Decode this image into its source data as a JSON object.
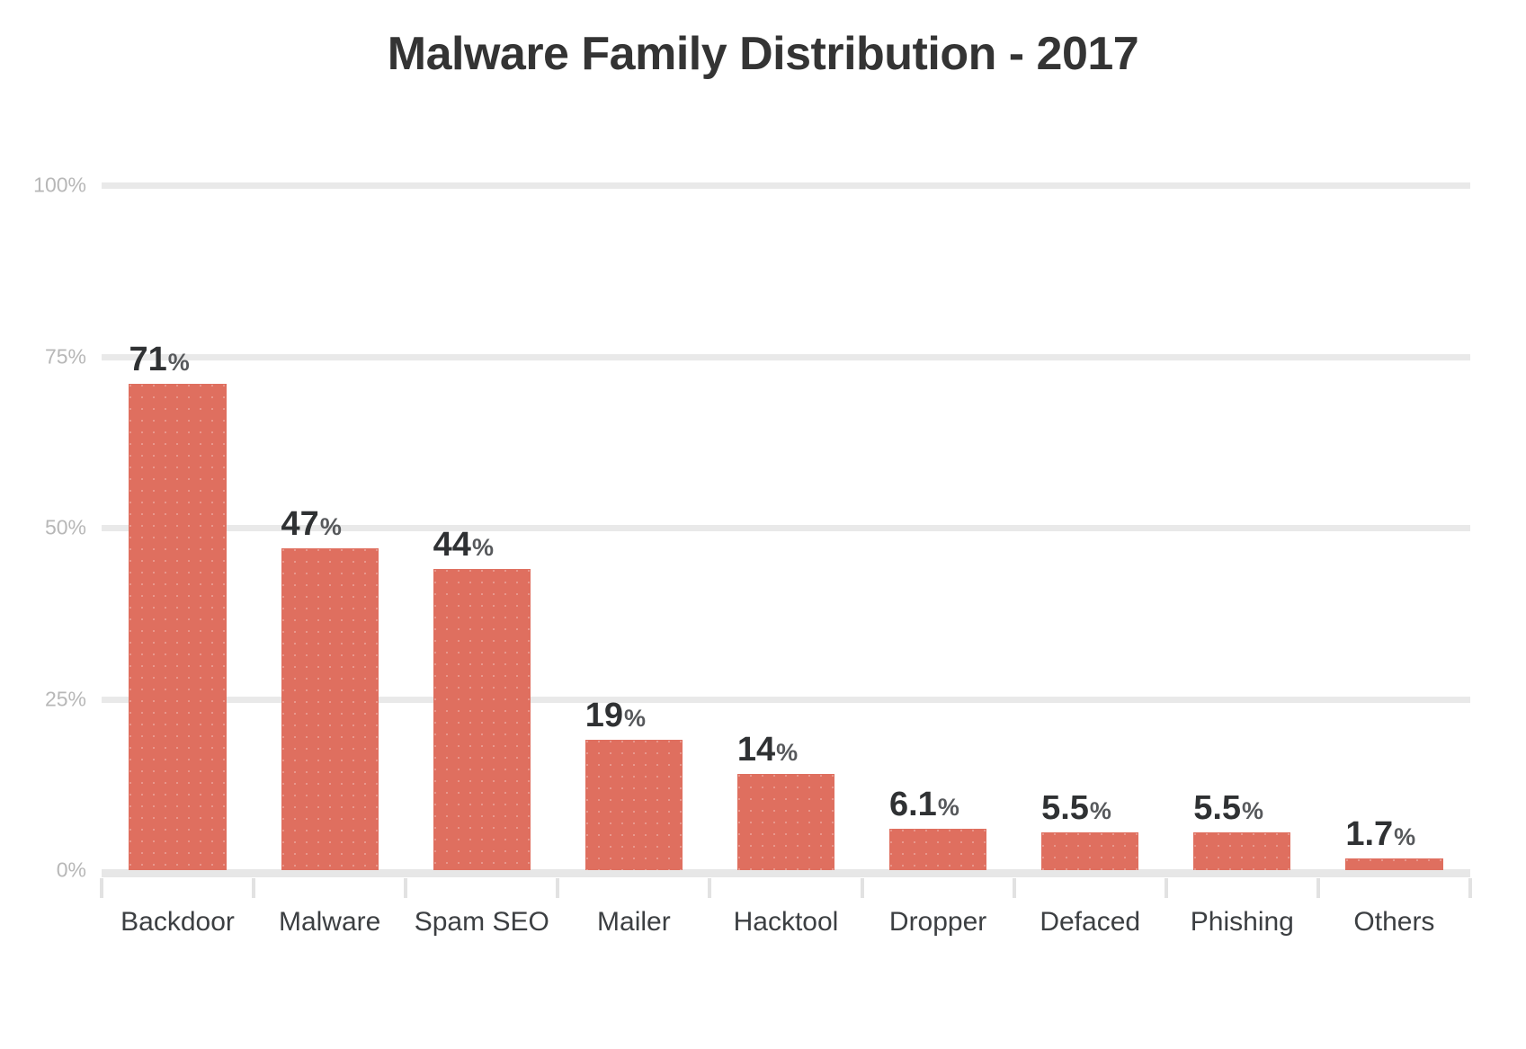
{
  "chart_data": {
    "type": "bar",
    "title": "Malware Family Distribution - 2017",
    "xlabel": "",
    "ylabel": "",
    "ylim": [
      0,
      100
    ],
    "grid": true,
    "legend": "none",
    "y_unit": "%",
    "y_ticks": [
      {
        "value": 100,
        "label": "100%"
      },
      {
        "value": 75,
        "label": "75%"
      },
      {
        "value": 50,
        "label": "50%"
      },
      {
        "value": 25,
        "label": "25%"
      },
      {
        "value": 0,
        "label": "0%"
      }
    ],
    "categories": [
      "Backdoor",
      "Malware",
      "Spam SEO",
      "Mailer",
      "Hacktool",
      "Dropper",
      "Defaced",
      "Phishing",
      "Others"
    ],
    "values": [
      71,
      47,
      44,
      19,
      14,
      6.1,
      5.5,
      5.5,
      1.7
    ],
    "point_labels": [
      "71",
      "47",
      "44",
      "19",
      "14",
      "6.1",
      "5.5",
      "5.5",
      "1.7"
    ],
    "point_label_suffix": "%",
    "bars": [
      {
        "category": "Backdoor",
        "value": 71,
        "number": "71",
        "suffix": "%"
      },
      {
        "category": "Malware",
        "value": 47,
        "number": "47",
        "suffix": "%"
      },
      {
        "category": "Spam SEO",
        "value": 44,
        "number": "44",
        "suffix": "%"
      },
      {
        "category": "Mailer",
        "value": 19,
        "number": "19",
        "suffix": "%"
      },
      {
        "category": "Hacktool",
        "value": 14,
        "number": "14",
        "suffix": "%"
      },
      {
        "category": "Dropper",
        "value": 6.1,
        "number": "6.1",
        "suffix": "%"
      },
      {
        "category": "Defaced",
        "value": 5.5,
        "number": "5.5",
        "suffix": "%"
      },
      {
        "category": "Phishing",
        "value": 5.5,
        "number": "5.5",
        "suffix": "%"
      },
      {
        "category": "Others",
        "value": 1.7,
        "number": "1.7",
        "suffix": "%"
      }
    ],
    "colors": {
      "bar": "#df6f5f",
      "title": "#343434",
      "value_label": "#2f3133",
      "percent_suffix": "#57595c",
      "gridline": "#e9e9e9",
      "tick_label": "#b7b7b7",
      "category_label": "#3c3f42",
      "background": "#ffffff"
    }
  }
}
